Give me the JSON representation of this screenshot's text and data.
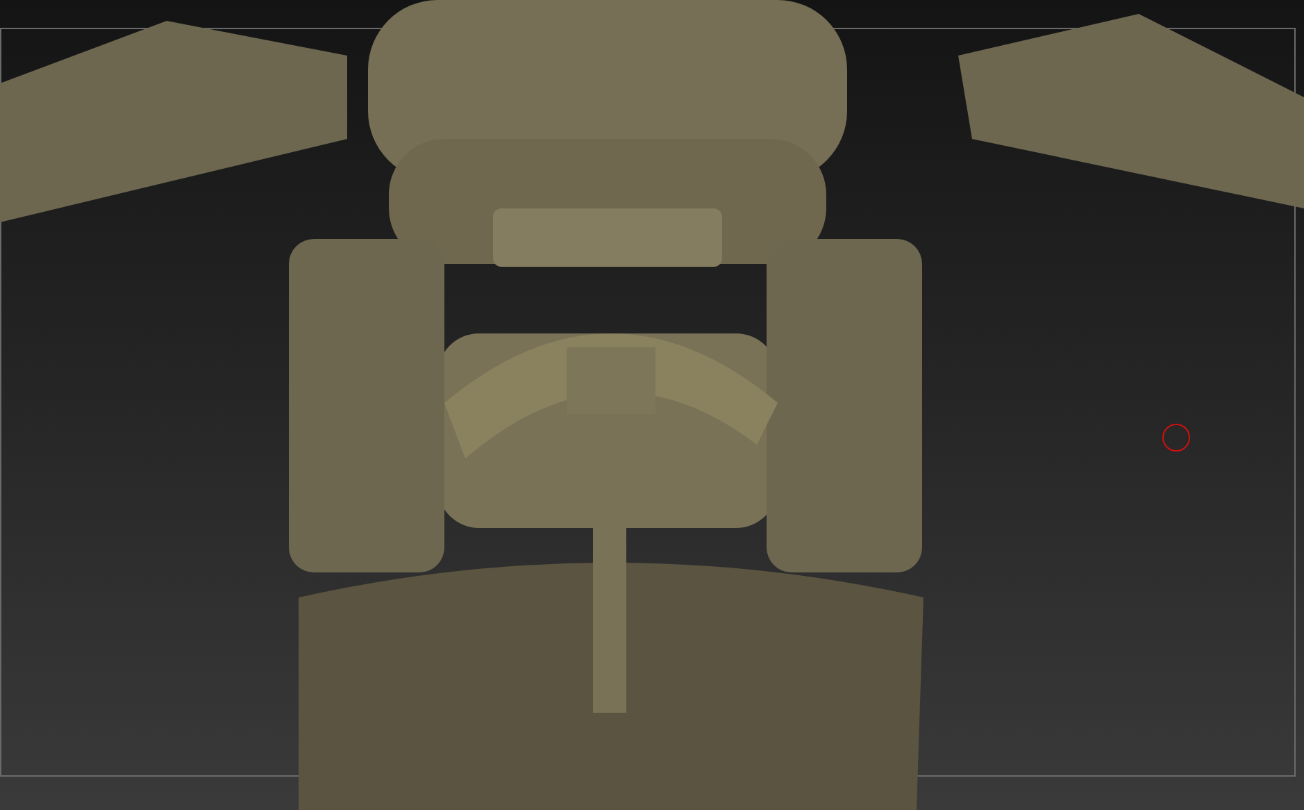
{
  "viewport": {
    "brush_cursor": true
  }
}
